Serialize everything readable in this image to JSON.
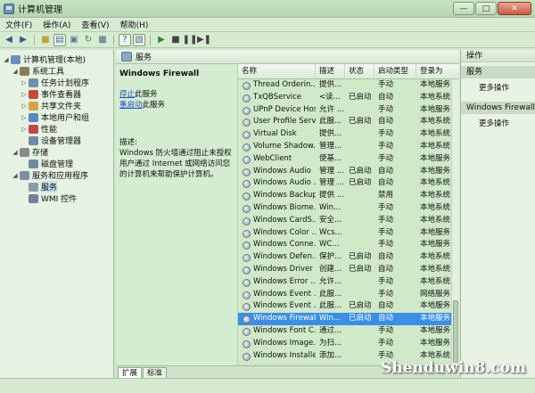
{
  "window": {
    "title": "计算机管理"
  },
  "menu": [
    "文件(F)",
    "操作(A)",
    "查看(V)",
    "帮助(H)"
  ],
  "tree": [
    {
      "label": "计算机管理(本地)",
      "level": 0,
      "expander": "◢",
      "color": "#6a8fb8"
    },
    {
      "label": "系统工具",
      "level": 1,
      "expander": "◢",
      "color": "#8c7a5c"
    },
    {
      "label": "任务计划程序",
      "level": 2,
      "expander": "▷",
      "color": "#6d8fb0"
    },
    {
      "label": "事件查看器",
      "level": 2,
      "expander": "▷",
      "color": "#c24b3c"
    },
    {
      "label": "共享文件夹",
      "level": 2,
      "expander": "▷",
      "color": "#d4a640"
    },
    {
      "label": "本地用户和组",
      "level": 2,
      "expander": "▷",
      "color": "#5a87c6"
    },
    {
      "label": "性能",
      "level": 2,
      "expander": "▷",
      "color": "#c24848"
    },
    {
      "label": "设备管理器",
      "level": 2,
      "expander": "",
      "color": "#6f8aa3"
    },
    {
      "label": "存储",
      "level": 1,
      "expander": "◢",
      "color": "#8a8a8a"
    },
    {
      "label": "磁盘管理",
      "level": 2,
      "expander": "",
      "color": "#6f8aa3"
    },
    {
      "label": "服务和应用程序",
      "level": 1,
      "expander": "◢",
      "color": "#7f8f9f"
    },
    {
      "label": "服务",
      "level": 2,
      "expander": "",
      "color": "#8a9aa8",
      "selected": true
    },
    {
      "label": "WMI 控件",
      "level": 2,
      "expander": "",
      "color": "#7c7c9c"
    }
  ],
  "center": {
    "header": "服务",
    "service_name": "Windows Firewall",
    "stop_link": "停止",
    "stop_suffix": "此服务",
    "restart_link": "重启动",
    "restart_suffix": "此服务",
    "desc_label": "描述:",
    "desc_text": "Windows 防火墙通过阻止未授权用户通过 Internet 或网络访问您的计算机来帮助保护计算机。"
  },
  "columns": [
    "名称",
    "描述",
    "状态",
    "启动类型",
    "登录为"
  ],
  "services": [
    {
      "name": "Thread Orderin...",
      "desc": "提供...",
      "status": "",
      "startup": "手动",
      "logon": "本地服务"
    },
    {
      "name": "TxQBService",
      "desc": "<读...",
      "status": "已启动",
      "startup": "自动",
      "logon": "本地系统"
    },
    {
      "name": "UPnP Device Host",
      "desc": "允许 ...",
      "status": "",
      "startup": "手动",
      "logon": "本地服务"
    },
    {
      "name": "User Profile Serv...",
      "desc": "此服...",
      "status": "已启动",
      "startup": "自动",
      "logon": "本地系统"
    },
    {
      "name": "Virtual Disk",
      "desc": "提供...",
      "status": "",
      "startup": "手动",
      "logon": "本地系统"
    },
    {
      "name": "Volume Shadow...",
      "desc": "管理...",
      "status": "",
      "startup": "手动",
      "logon": "本地系统"
    },
    {
      "name": "WebClient",
      "desc": "使基...",
      "status": "",
      "startup": "手动",
      "logon": "本地服务"
    },
    {
      "name": "Windows Audio",
      "desc": "管理 ...",
      "status": "已启动",
      "startup": "自动",
      "logon": "本地服务"
    },
    {
      "name": "Windows Audio ...",
      "desc": "管理 ...",
      "status": "已启动",
      "startup": "自动",
      "logon": "本地系统"
    },
    {
      "name": "Windows Backup",
      "desc": "提供 ...",
      "status": "",
      "startup": "禁用",
      "logon": "本地系统"
    },
    {
      "name": "Windows Biome...",
      "desc": "Win...",
      "status": "",
      "startup": "手动",
      "logon": "本地系统"
    },
    {
      "name": "Windows CardS...",
      "desc": "安全...",
      "status": "",
      "startup": "手动",
      "logon": "本地系统"
    },
    {
      "name": "Windows Color ...",
      "desc": "Wcs...",
      "status": "",
      "startup": "手动",
      "logon": "本地服务"
    },
    {
      "name": "Windows Conne...",
      "desc": "WC...",
      "status": "",
      "startup": "手动",
      "logon": "本地服务"
    },
    {
      "name": "Windows Defen...",
      "desc": "保护...",
      "status": "已启动",
      "startup": "自动",
      "logon": "本地系统"
    },
    {
      "name": "Windows Driver ...",
      "desc": "创建...",
      "status": "已启动",
      "startup": "自动",
      "logon": "本地系统"
    },
    {
      "name": "Windows Error ...",
      "desc": "允许...",
      "status": "",
      "startup": "手动",
      "logon": "本地系统"
    },
    {
      "name": "Windows Event ...",
      "desc": "此服...",
      "status": "",
      "startup": "手动",
      "logon": "网络服务"
    },
    {
      "name": "Windows Event ...",
      "desc": "此服...",
      "status": "已启动",
      "startup": "自动",
      "logon": "本地服务"
    },
    {
      "name": "Windows Firewall",
      "desc": "Win...",
      "status": "已启动",
      "startup": "自动",
      "logon": "本地服务",
      "selected": true
    },
    {
      "name": "Windows Font C...",
      "desc": "通过...",
      "status": "",
      "startup": "手动",
      "logon": "本地服务"
    },
    {
      "name": "Windows Image...",
      "desc": "为扫...",
      "status": "",
      "startup": "手动",
      "logon": "本地服务"
    },
    {
      "name": "Windows Installer",
      "desc": "添加...",
      "status": "",
      "startup": "手动",
      "logon": "本地系统"
    }
  ],
  "tabs": [
    "扩展",
    "标准"
  ],
  "actions": {
    "header": "操作",
    "section1": "服务",
    "section1_item": "更多操作",
    "section2": "Windows Firewall",
    "section2_item": "更多操作"
  },
  "watermark": "Shenduwin8.com"
}
